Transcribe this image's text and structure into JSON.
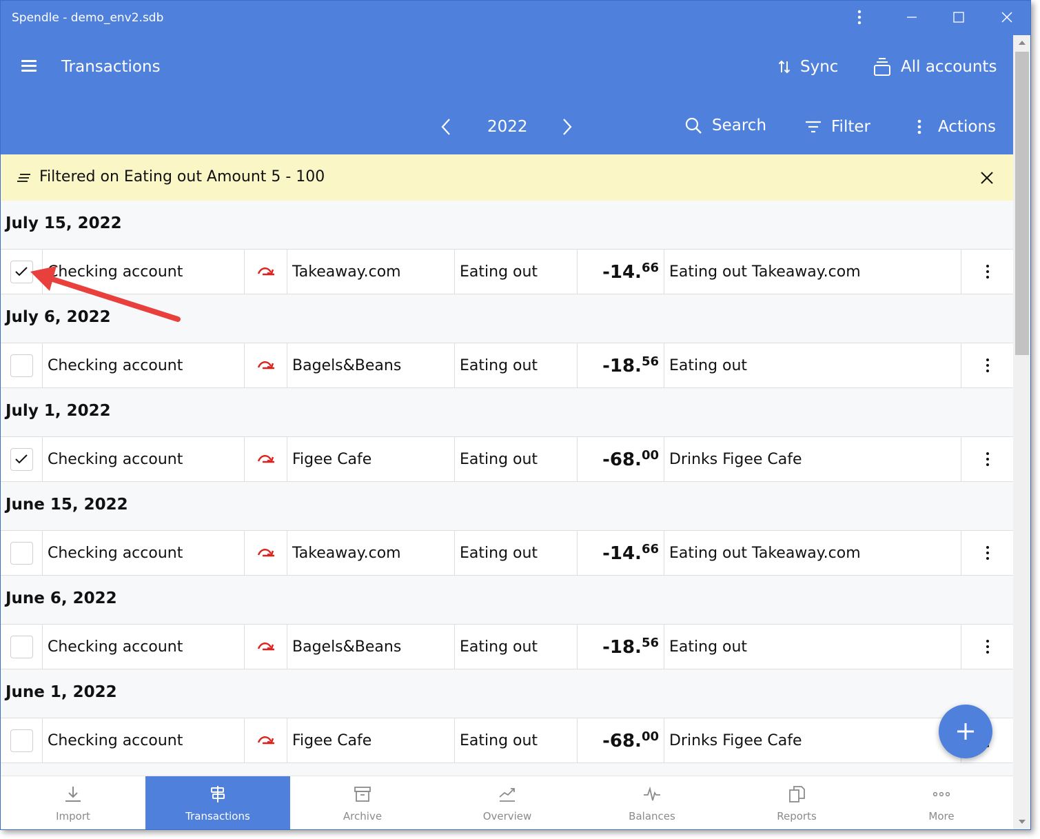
{
  "window": {
    "title": "Spendle - demo_env2.sdb"
  },
  "header": {
    "title": "Transactions",
    "sync_label": "Sync",
    "accounts_label": "All accounts",
    "year": "2022",
    "search_label": "Search",
    "filter_label": "Filter",
    "actions_label": "Actions"
  },
  "filter_banner": {
    "text": "Filtered on Eating out Amount 5 - 100"
  },
  "groups": [
    {
      "date": "July 15, 2022",
      "rows": [
        {
          "checked": true,
          "account": "Checking account",
          "payee": "Takeaway.com",
          "category": "Eating out",
          "amount_main": "-14.",
          "amount_cents": "66",
          "description": "Eating out Takeaway.com"
        }
      ]
    },
    {
      "date": "July 6, 2022",
      "rows": [
        {
          "checked": false,
          "account": "Checking account",
          "payee": "Bagels&Beans",
          "category": "Eating out",
          "amount_main": "-18.",
          "amount_cents": "56",
          "description": "Eating out"
        }
      ]
    },
    {
      "date": "July 1, 2022",
      "rows": [
        {
          "checked": true,
          "account": "Checking account",
          "payee": "Figee Cafe",
          "category": "Eating out",
          "amount_main": "-68.",
          "amount_cents": "00",
          "description": "Drinks Figee Cafe"
        }
      ]
    },
    {
      "date": "June 15, 2022",
      "rows": [
        {
          "checked": false,
          "account": "Checking account",
          "payee": "Takeaway.com",
          "category": "Eating out",
          "amount_main": "-14.",
          "amount_cents": "66",
          "description": "Eating out Takeaway.com"
        }
      ]
    },
    {
      "date": "June 6, 2022",
      "rows": [
        {
          "checked": false,
          "account": "Checking account",
          "payee": "Bagels&Beans",
          "category": "Eating out",
          "amount_main": "-18.",
          "amount_cents": "56",
          "description": "Eating out"
        }
      ]
    },
    {
      "date": "June 1, 2022",
      "rows": [
        {
          "checked": false,
          "account": "Checking account",
          "payee": "Figee Cafe",
          "category": "Eating out",
          "amount_main": "-68.",
          "amount_cents": "00",
          "description": "Drinks Figee Cafe"
        }
      ]
    }
  ],
  "bottom_nav": [
    {
      "label": "Import",
      "icon": "download-icon",
      "active": false
    },
    {
      "label": "Transactions",
      "icon": "transactions-icon",
      "active": true
    },
    {
      "label": "Archive",
      "icon": "archive-icon",
      "active": false
    },
    {
      "label": "Overview",
      "icon": "trend-icon",
      "active": false
    },
    {
      "label": "Balances",
      "icon": "pulse-icon",
      "active": false
    },
    {
      "label": "Reports",
      "icon": "reports-icon",
      "active": false
    },
    {
      "label": "More",
      "icon": "more-dots-icon",
      "active": false
    }
  ],
  "colors": {
    "primary": "#4f81dc",
    "banner": "#fbf6c6",
    "transfer_icon": "#e0201b",
    "annotation_arrow": "#e8413d"
  }
}
